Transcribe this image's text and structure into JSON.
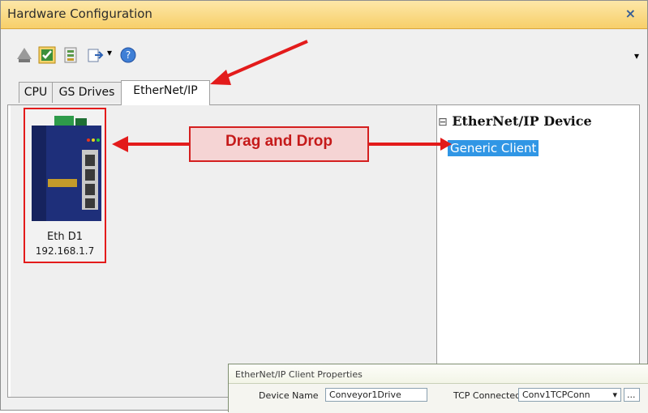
{
  "window": {
    "title": "Hardware Configuration",
    "close_glyph": "×",
    "toolbar_more_glyph": "▾"
  },
  "toolbar": {
    "icons": [
      "network-icon",
      "checklist-icon",
      "io-config-icon",
      "export-icon",
      "help-icon"
    ],
    "dropdown_glyph": "▾"
  },
  "tabs": [
    {
      "label": "CPU",
      "active": false
    },
    {
      "label": "GS Drives",
      "active": false
    },
    {
      "label": "EtherNet/IP",
      "active": true
    }
  ],
  "device": {
    "name": "Eth D1",
    "ip": "192.168.1.7"
  },
  "tree": {
    "toggle_glyph": "⊟",
    "root": "EtherNet/IP Device",
    "children": [
      "Generic Client"
    ]
  },
  "annotation": {
    "callout": "Drag and Drop"
  },
  "properties_dialog": {
    "title": "EtherNet/IP Client Properties",
    "device_name_label": "Device Name",
    "device_name_value": "Conveyor1Drive",
    "tcp_connected_label": "TCP Connected",
    "tcp_connected_value": "Conv1TCPConn",
    "browse_label": "..."
  },
  "colors": {
    "title_bar": "#f7cf69",
    "annotation_red": "#d41f1f",
    "selection_blue": "#3096e5"
  }
}
